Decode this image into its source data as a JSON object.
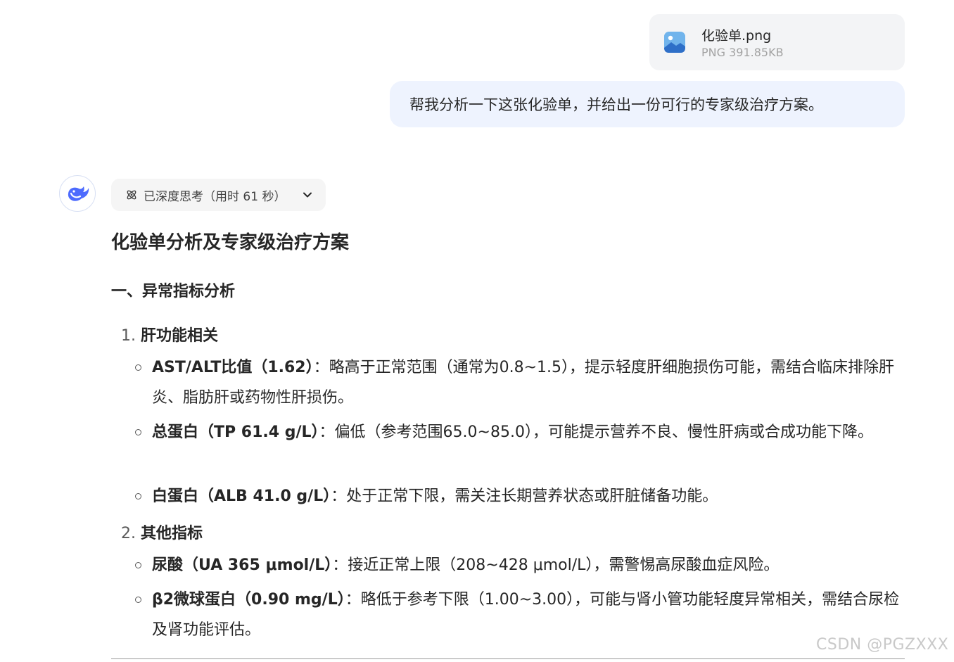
{
  "attachment": {
    "icon": "image-file-icon",
    "name": "化验单.png",
    "meta": "PNG 391.85KB"
  },
  "user_message": "帮我分析一下这张化验单，并给出一份可行的专家级治疗方案。",
  "assistant": {
    "avatar_icon": "whale-logo-icon",
    "thinking_label": "已深度思考（用时 61 秒）",
    "title": "化验单分析及专家级治疗方案",
    "section_heading": "一、异常指标分析",
    "groups": [
      {
        "number": "1.",
        "title": "肝功能相关",
        "bullets": [
          {
            "bold": "AST/ALT比值（1.62）",
            "text": "：略高于正常范围（通常为0.8~1.5），提示轻度肝细胞损伤可能，需结合临床排除肝炎、脂肪肝或药物性肝损伤。"
          },
          {
            "bold": "总蛋白（TP 61.4 g/L）",
            "text": "：偏低（参考范围65.0~85.0），可能提示营养不良、慢性肝病或合成功能下降。"
          },
          {
            "bold": "白蛋白（ALB 41.0 g/L）",
            "text": "：处于正常下限，需关注长期营养状态或肝脏储备功能。"
          }
        ]
      },
      {
        "number": "2.",
        "title": "其他指标",
        "bullets": [
          {
            "bold": "尿酸（UA 365 μmol/L）",
            "text": "：接近正常上限（208~428 μmol/L），需警惕高尿酸血症风险。"
          },
          {
            "bold": "β2微球蛋白（0.90 mg/L）",
            "text": "：略低于参考下限（1.00~3.00），可能与肾小管功能轻度异常相关，需结合尿检及肾功能评估。"
          }
        ]
      }
    ]
  },
  "watermark": "CSDN @PGZXXX",
  "colors": {
    "user_bubble": "#eef3fe",
    "file_card": "#f3f4f6",
    "brand": "#4d6bfe"
  }
}
